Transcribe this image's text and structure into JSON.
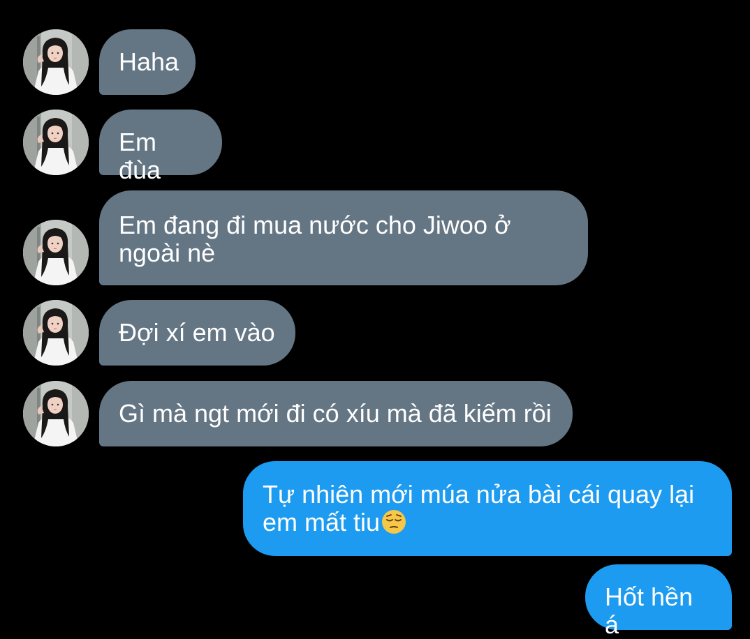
{
  "conversation": {
    "contact_avatar_icon": "contact-photo-avatar",
    "colors": {
      "background": "#000000",
      "incoming_bubble": "#647584",
      "outgoing_bubble": "#1d9bf0",
      "text": "#ffffff"
    },
    "messages": [
      {
        "direction": "incoming",
        "text": "Haha"
      },
      {
        "direction": "incoming",
        "text": "Em đùa"
      },
      {
        "direction": "incoming",
        "text": "Em đang đi mua nước cho Jiwoo ở ngoài nè"
      },
      {
        "direction": "incoming",
        "text": "Đợi xí em vào"
      },
      {
        "direction": "incoming",
        "text": "Gì mà ngt mới đi có xíu mà đã kiếm rồi"
      },
      {
        "direction": "outgoing",
        "text": "Tự nhiên mới múa nửa bài cái quay lại em mất tiu",
        "emoji": "pensive-face-emoji"
      },
      {
        "direction": "outgoing",
        "text": "Hốt hền á"
      }
    ]
  }
}
